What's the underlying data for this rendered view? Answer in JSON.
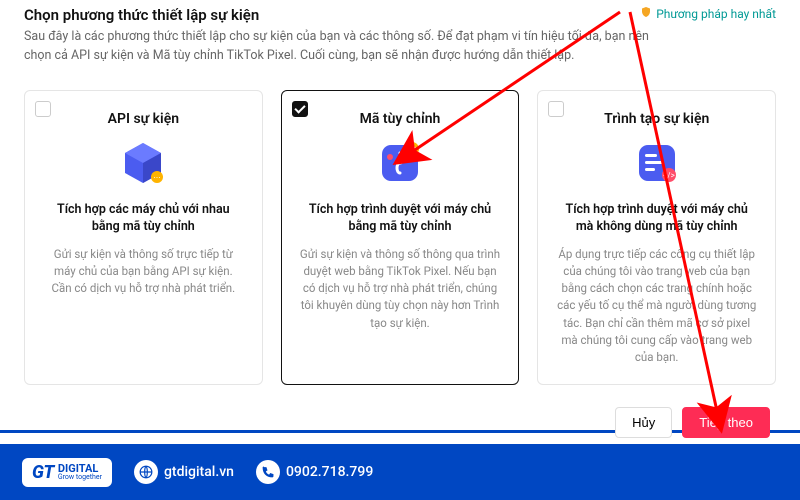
{
  "header": {
    "title": "Chọn phương thức thiết lập sự kiện",
    "best_practice": "Phương pháp hay nhất",
    "subtitle": "Sau đây là các phương thức thiết lập cho sự kiện của bạn và các thông số. Để đạt phạm vi tín hiệu tối đa, bạn nên chọn cả API sự kiện và Mã tùy chỉnh TikTok Pixel. Cuối cùng, bạn sẽ nhận được hướng dẫn thiết lập."
  },
  "cards": [
    {
      "title": "API sự kiện",
      "icon": "cube-api-icon",
      "heading": "Tích hợp các máy chủ với nhau bằng mã tùy chỉnh",
      "desc": "Gửi sự kiện và thông số trực tiếp từ máy chủ của bạn bằng API sự kiện. Cần có dịch vụ hỗ trợ nhà phát triển.",
      "selected": false
    },
    {
      "title": "Mã tùy chỉnh",
      "icon": "custom-code-icon",
      "heading": "Tích hợp trình duyệt với máy chủ bằng mã tùy chỉnh",
      "desc": "Gửi sự kiện và thông số thông qua trình duyệt web bằng TikTok Pixel. Nếu bạn có dịch vụ hỗ trợ nhà phát triển, chúng tôi khuyên dùng tùy chọn này hơn Trình tạo sự kiện.",
      "selected": true
    },
    {
      "title": "Trình tạo sự kiện",
      "icon": "event-builder-icon",
      "heading": "Tích hợp trình duyệt với máy chủ mà không dùng mã tùy chỉnh",
      "desc": "Áp dụng trực tiếp các công cụ thiết lập của chúng tôi vào trang web của bạn bằng cách chọn các trang chính hoặc các yếu tố cụ thể mà người dùng tương tác. Bạn chỉ cần thêm mã cơ sở pixel mà chúng tôi cung cấp vào trang web của bạn.",
      "selected": false
    }
  ],
  "actions": {
    "cancel": "Hủy",
    "next": "Tiếp theo"
  },
  "brand": {
    "logo_main": "GT",
    "logo_text": "DIGITAL",
    "logo_tag": "Grow together",
    "website": "gtdigital.vn",
    "phone": "0902.718.799"
  }
}
